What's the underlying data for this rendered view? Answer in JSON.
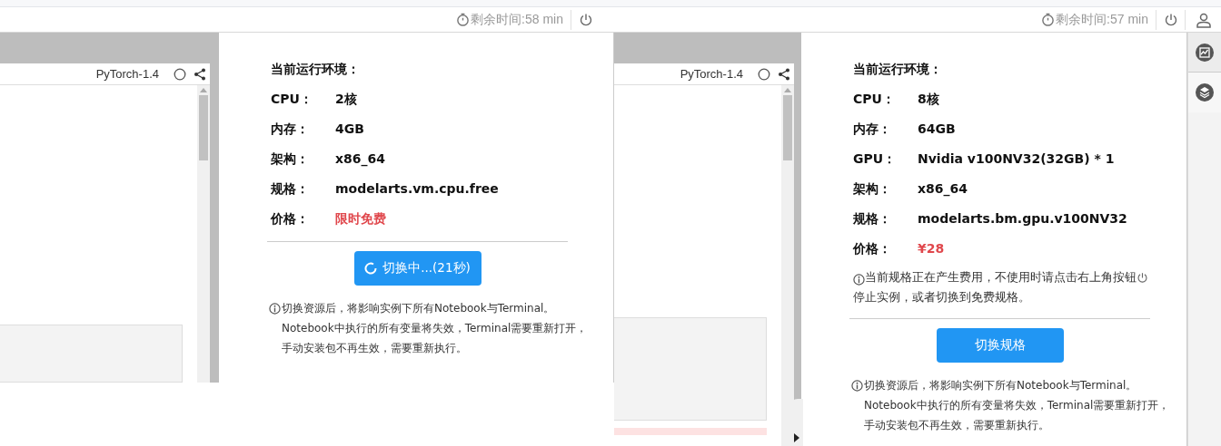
{
  "screens": [
    {
      "timer": "剩余时间:58 min",
      "account_button": false,
      "kernel": "PyTorch-1.4",
      "env_title": "当前运行环境：",
      "specs": [
        {
          "label": "CPU：",
          "value": "2核",
          "kind": "plain"
        },
        {
          "label": "内存：",
          "value": "4GB",
          "kind": "plain"
        },
        {
          "label": "架构：",
          "value": "x86_64",
          "kind": "plain"
        },
        {
          "label": "规格：",
          "value": "modelarts.vm.cpu.free",
          "kind": "plain"
        },
        {
          "label": "价格：",
          "value": "限时免费",
          "kind": "price"
        }
      ],
      "button": {
        "label": "切换中...(21秒)",
        "loading": true
      },
      "notice": "切换资源后，将影响实例下所有Notebook与Terminal。Notebook中执行的所有变量将失效，Terminal需要重新打开，手动安装包不再生效，需要重新执行。"
    },
    {
      "timer": "剩余时间:57 min",
      "account_button": true,
      "kernel": "PyTorch-1.4",
      "env_title": "当前运行环境：",
      "specs": [
        {
          "label": "CPU：",
          "value": "8核",
          "kind": "plain"
        },
        {
          "label": "内存：",
          "value": "64GB",
          "kind": "plain"
        },
        {
          "label": "GPU：",
          "value": "Nvidia v100NV32(32GB) * 1",
          "kind": "plain"
        },
        {
          "label": "架构：",
          "value": "x86_64",
          "kind": "plain"
        },
        {
          "label": "规格：",
          "value": "modelarts.bm.gpu.v100NV32",
          "kind": "plain"
        },
        {
          "label": "价格：",
          "value": "¥28",
          "kind": "price"
        }
      ],
      "cost_notice": {
        "before": "当前规格正在产生费用，不使用时请点击右上角按钮",
        "after": "停止实例，或者切换到免费规格。"
      },
      "button": {
        "label": "切换规格",
        "loading": false
      },
      "notice": "切换资源后，将影响实例下所有Notebook与Terminal。Notebook中执行的所有变量将失效，Terminal需要重新打开，手动安装包不再生效，需要重新执行。",
      "side_rail": [
        {
          "selected": true
        },
        {
          "selected": false
        }
      ]
    }
  ]
}
